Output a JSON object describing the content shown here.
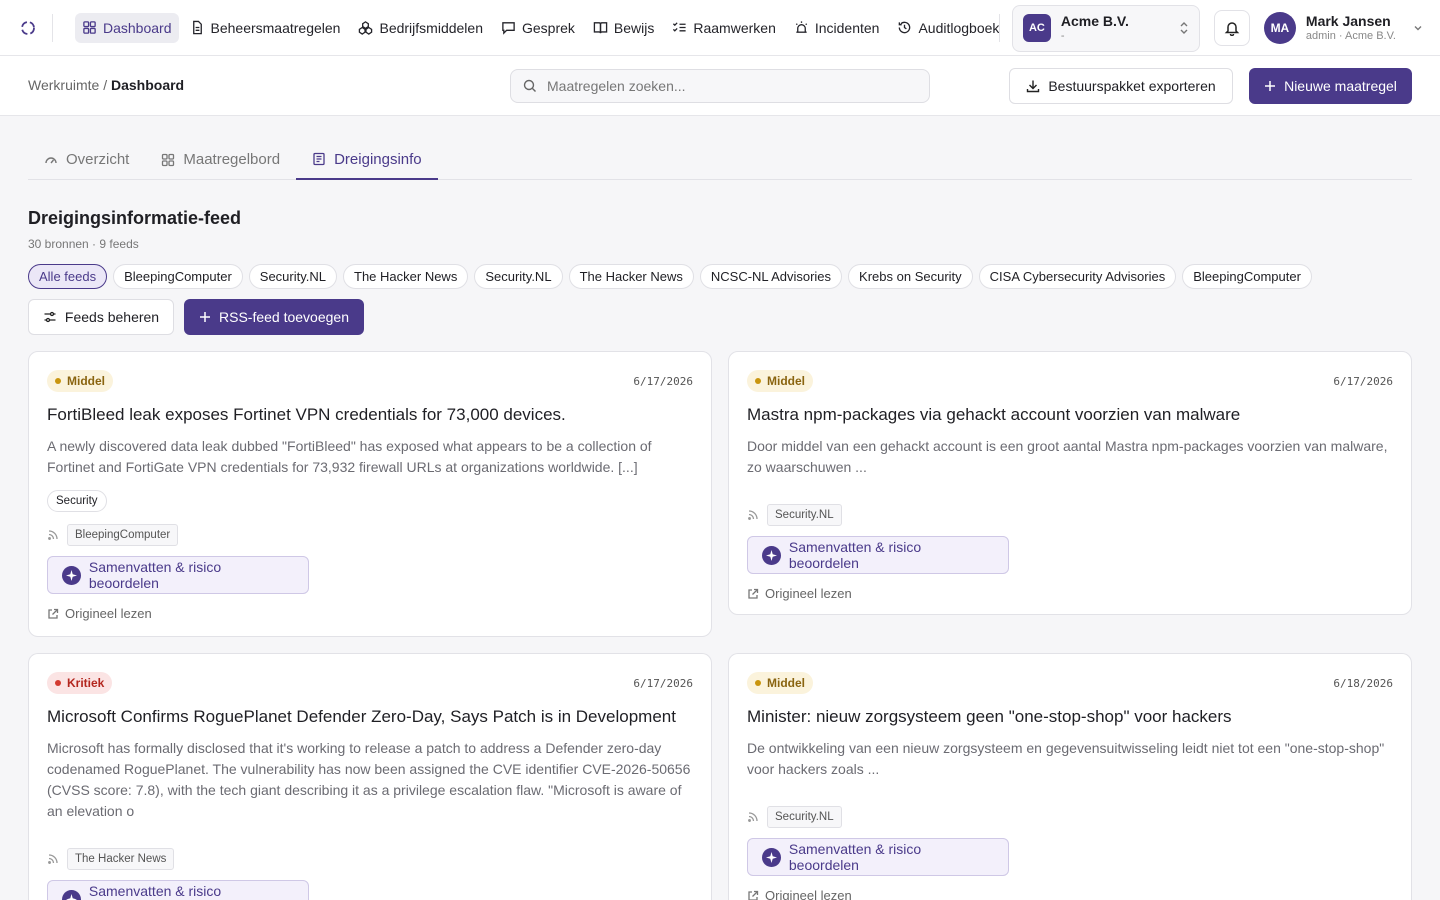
{
  "nav": {
    "items": [
      {
        "label": "Dashboard",
        "icon": "grid-icon",
        "active": true
      },
      {
        "label": "Beheersmaatregelen",
        "icon": "document-icon"
      },
      {
        "label": "Bedrijfsmiddelen",
        "icon": "assets-icon"
      },
      {
        "label": "Gesprek",
        "icon": "chat-icon"
      },
      {
        "label": "Bewijs",
        "icon": "book-icon"
      },
      {
        "label": "Raamwerken",
        "icon": "checklist-icon"
      },
      {
        "label": "Incidenten",
        "icon": "siren-icon"
      },
      {
        "label": "Auditlogboek",
        "icon": "history-icon"
      }
    ]
  },
  "org": {
    "badge": "AC",
    "name": "Acme B.V.",
    "sub": "-"
  },
  "user": {
    "initials": "MA",
    "name": "Mark Jansen",
    "role": "admin · Acme B.V."
  },
  "breadcrumb": {
    "root": "Werkruimte",
    "sep": "/",
    "current": "Dashboard"
  },
  "search": {
    "placeholder": "Maatregelen zoeken..."
  },
  "actions": {
    "export": "Bestuurspakket exporteren",
    "new": "Nieuwe maatregel"
  },
  "tabs": [
    {
      "label": "Overzicht"
    },
    {
      "label": "Maatregelbord"
    },
    {
      "label": "Dreigingsinfo",
      "active": true
    }
  ],
  "feed": {
    "title": "Dreigingsinformatie-feed",
    "subtitle": "30 bronnen · 9 feeds",
    "chips": [
      "Alle feeds",
      "BleepingComputer",
      "Security.NL",
      "The Hacker News",
      "Security.NL",
      "The Hacker News",
      "NCSC-NL Advisories",
      "Krebs on Security",
      "CISA Cybersecurity Advisories",
      "BleepingComputer"
    ],
    "manage": "Feeds beheren",
    "add": "RSS-feed toevoegen"
  },
  "common": {
    "ai_label": "Samenvatten & risico beoordelen",
    "original_label": "Origineel lezen"
  },
  "cards": [
    {
      "severity": "Middel",
      "date": "6/17/2026",
      "title": "FortiBleed leak exposes Fortinet VPN credentials for 73,000 devices.",
      "description": "A newly discovered data leak dubbed \"FortiBleed\" has exposed what appears to be a collection of Fortinet and FortiGate VPN credentials for 73,932 firewall URLs at organizations worldwide. [...]",
      "tag": "Security",
      "source": "BleepingComputer"
    },
    {
      "severity": "Middel",
      "date": "6/17/2026",
      "title": "Mastra npm-packages via gehackt account voorzien van malware",
      "description": "Door middel van een gehackt account is een groot aantal Mastra npm-packages voorzien van malware, zo waarschuwen ...",
      "source": "Security.NL"
    },
    {
      "severity": "Kritiek",
      "date": "6/17/2026",
      "title": "Microsoft Confirms RoguePlanet Defender Zero-Day, Says Patch is in Development",
      "description": "Microsoft has formally disclosed that it's working to release a patch to address a Defender zero-day codenamed RoguePlanet. The vulnerability has now been assigned the CVE identifier CVE-2026-50656 (CVSS score: 7.8), with the tech giant describing it as a privilege escalation flaw. \"Microsoft is aware of an elevation o",
      "source": "The Hacker News"
    },
    {
      "severity": "Middel",
      "date": "6/18/2026",
      "title": "Minister: nieuw zorgsysteem geen \"one-stop-shop\" voor hackers",
      "description": "De ontwikkeling van een nieuw zorgsysteem en gegevensuitwisseling leidt niet tot een \"one-stop-shop\" voor hackers zoals ...",
      "source": "Security.NL"
    }
  ],
  "colors": {
    "accent": "#4a3a8a",
    "middel": "#c9950e",
    "kritiek": "#d33a30"
  }
}
